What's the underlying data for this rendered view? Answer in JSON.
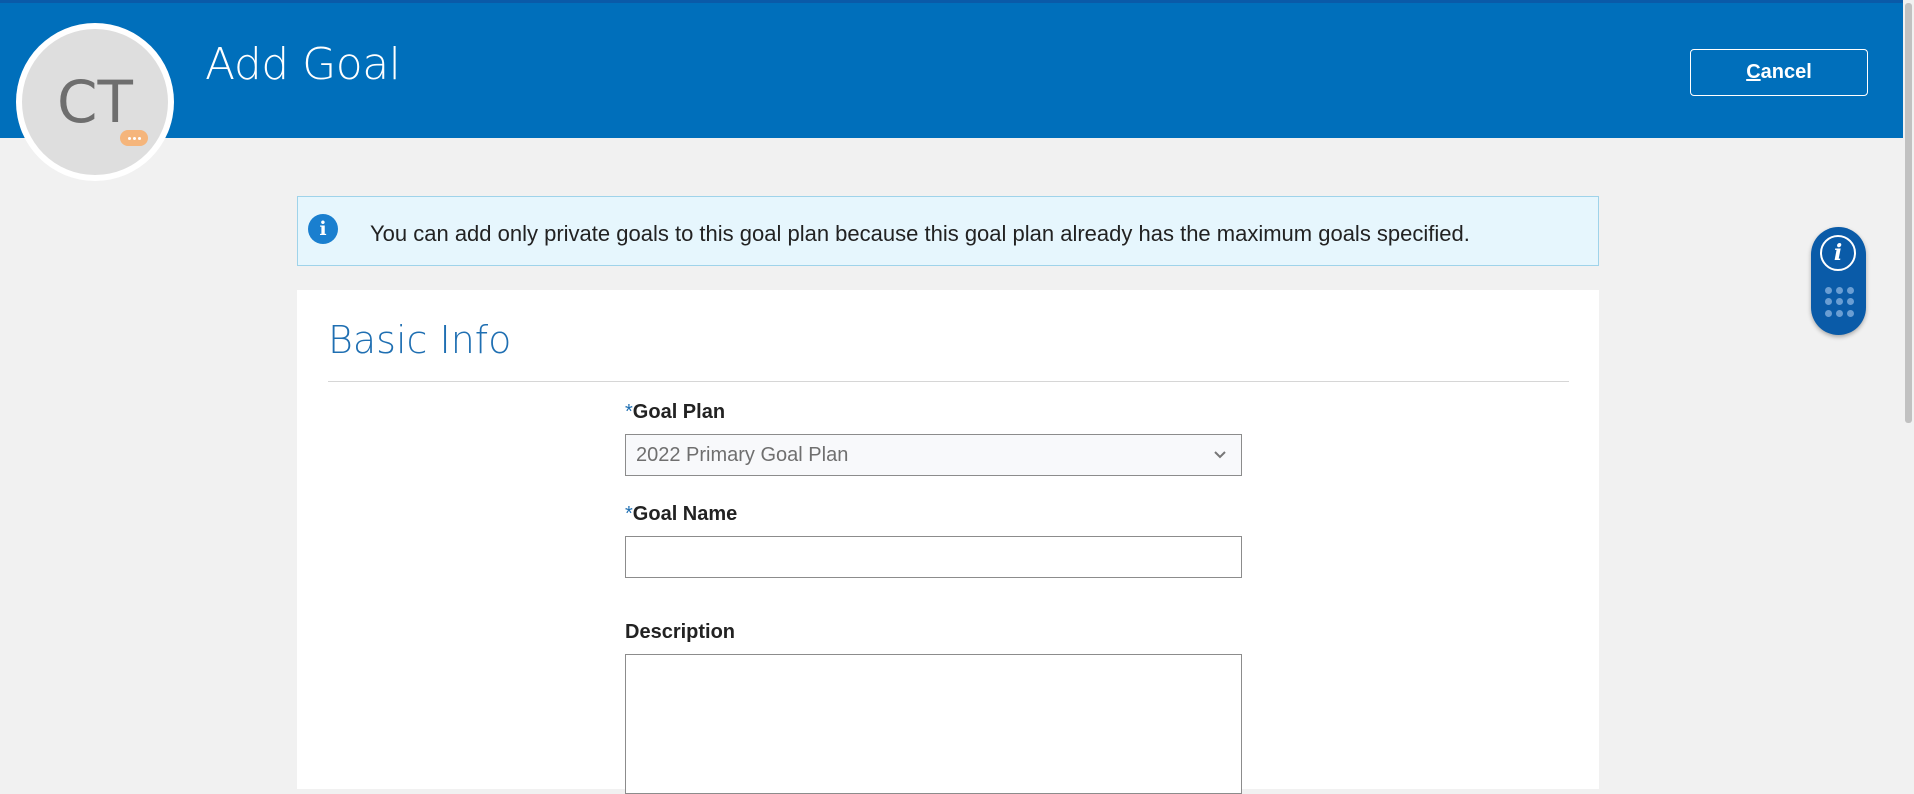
{
  "header": {
    "title": "Add Goal",
    "avatar_initials": "CT",
    "cancel_label_rest": "ancel",
    "cancel_label_mnemonic": "C",
    "bg_color": "#006fbb"
  },
  "banner": {
    "icon": "info-icon",
    "message": "You can add only private goals to this goal plan because this goal plan already has the maximum goals specified."
  },
  "basic_info": {
    "section_title": "Basic Info",
    "goal_plan": {
      "required_mark": "*",
      "label": "Goal Plan",
      "value": "2022 Primary Goal Plan"
    },
    "goal_name": {
      "required_mark": "*",
      "label": "Goal Name",
      "value": ""
    },
    "description": {
      "label": "Description",
      "value": ""
    }
  },
  "side_panel": {
    "info_icon": "info-icon",
    "apps_icon": "apps-grid-icon"
  }
}
